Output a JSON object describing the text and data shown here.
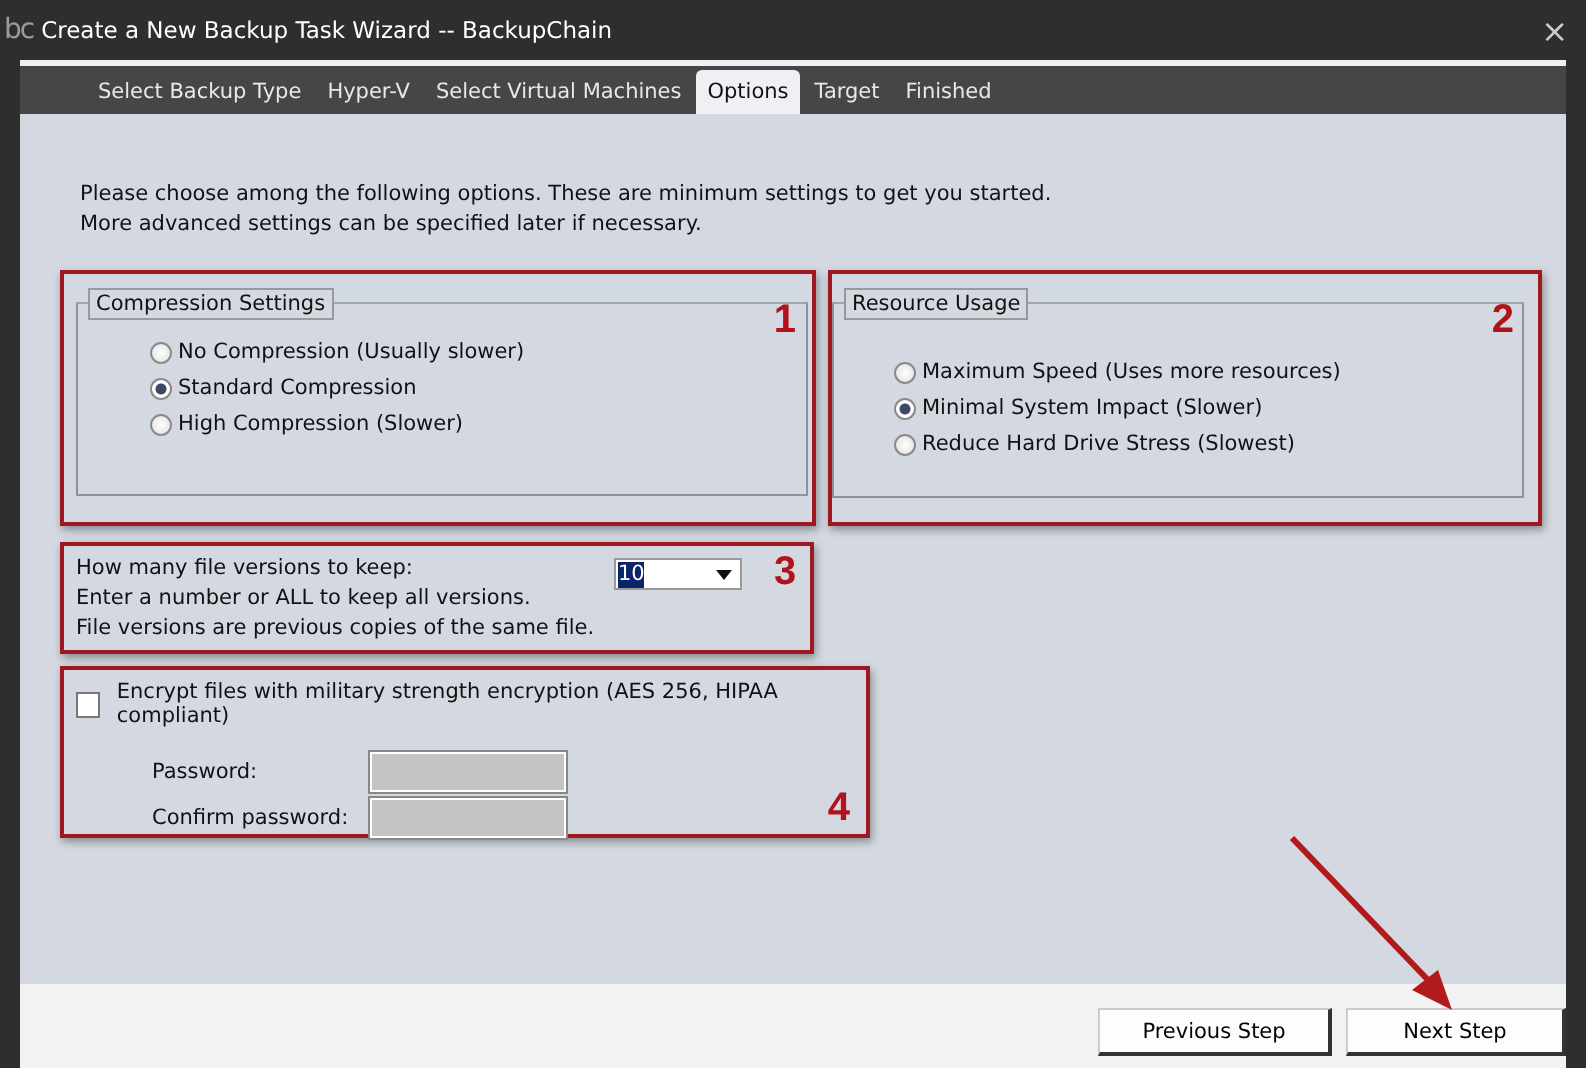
{
  "window": {
    "logo": "bc",
    "title": "Create a New Backup Task Wizard -- BackupChain",
    "close": "×"
  },
  "tabs": [
    {
      "label": "Select Backup Type",
      "selected": false
    },
    {
      "label": "Hyper-V",
      "selected": false
    },
    {
      "label": "Select Virtual Machines",
      "selected": false
    },
    {
      "label": "Options",
      "selected": true
    },
    {
      "label": "Target",
      "selected": false
    },
    {
      "label": "Finished",
      "selected": false
    }
  ],
  "intro": [
    "Please choose among the following options. These are minimum settings to get you started.",
    "More advanced settings can be specified later if necessary."
  ],
  "compression": {
    "callout": "1",
    "title": "Compression Settings",
    "options": [
      {
        "label": "No Compression (Usually slower)",
        "selected": false
      },
      {
        "label": "Standard Compression",
        "selected": true
      },
      {
        "label": "High Compression (Slower)",
        "selected": false
      }
    ]
  },
  "resource_usage": {
    "callout": "2",
    "title": "Resource Usage",
    "options": [
      {
        "label": "Maximum Speed (Uses more resources)",
        "selected": false
      },
      {
        "label": "Minimal System Impact (Slower)",
        "selected": true
      },
      {
        "label": "Reduce Hard Drive Stress (Slowest)",
        "selected": false
      }
    ]
  },
  "versions": {
    "callout": "3",
    "lines": [
      "How many file versions to keep:",
      "Enter a number or ALL to keep all versions.",
      "File versions are previous copies of the same file."
    ],
    "value": "10"
  },
  "encryption": {
    "callout": "4",
    "label": "Encrypt files with military strength encryption (AES 256, HIPAA compliant)",
    "checked": false,
    "fields": [
      {
        "label": "Password:",
        "disabled": true
      },
      {
        "label": "Confirm password:",
        "disabled": true
      }
    ]
  },
  "buttons": [
    "Previous Step",
    "Next Step"
  ]
}
